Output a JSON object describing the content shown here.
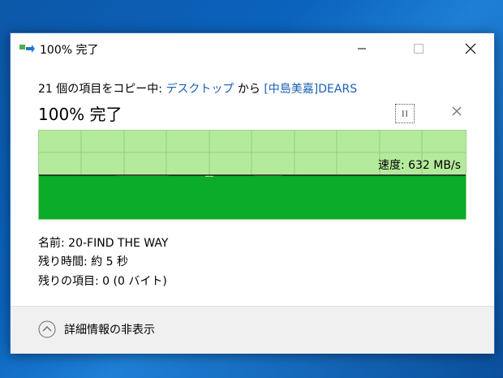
{
  "window": {
    "title": "100% 完了",
    "controls": [
      "minimize",
      "maximize",
      "close"
    ]
  },
  "copy": {
    "prefix": "21 個の項目をコピー中: ",
    "source": "デスクトップ",
    "middle": " から ",
    "destination": "[中島美嘉]DEARS",
    "status": "100% 完了"
  },
  "graph": {
    "speed_label": "速度: 632 MB/s",
    "progress_percent": 100,
    "colors": {
      "fill": "#0aac2a",
      "background": "#b4ea9c",
      "grid": "#8fd07a"
    }
  },
  "details": {
    "name_label": "名前: ",
    "name_value": "20-FIND THE WAY",
    "time_label": "残り時間: ",
    "time_value": "約 5 秒",
    "items_label": "残りの項目: ",
    "items_value": "0 (0 バイト)"
  },
  "footer": {
    "toggle_label": "詳細情報の非表示"
  }
}
